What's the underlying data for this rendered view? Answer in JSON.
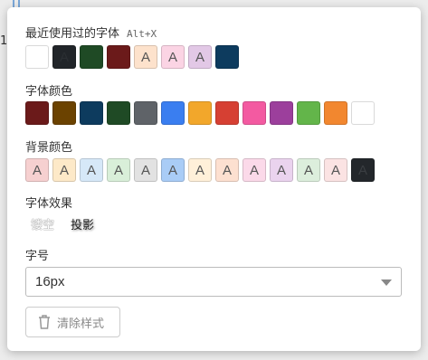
{
  "recent": {
    "title": "最近使用过的字体",
    "shortcut": "Alt+X",
    "swatches": [
      {
        "bg": "#ffffff",
        "letter": "",
        "fg": "#555"
      },
      {
        "bg": "#212529",
        "letter": "A",
        "fg": "#2b2f33"
      },
      {
        "bg": "#1f4a25",
        "letter": "",
        "fg": "#555"
      },
      {
        "bg": "#6b1a1a",
        "letter": "",
        "fg": "#555"
      },
      {
        "bg": "#fde2cc",
        "letter": "A",
        "fg": "#555"
      },
      {
        "bg": "#fbd4e4",
        "letter": "A",
        "fg": "#555"
      },
      {
        "bg": "#e2c8e6",
        "letter": "A",
        "fg": "#555"
      },
      {
        "bg": "#0d3b5e",
        "letter": "",
        "fg": "#555"
      }
    ]
  },
  "font_color": {
    "title": "字体颜色",
    "swatches": [
      "#6b1a1a",
      "#6b4200",
      "#0d3b5e",
      "#1f4a25",
      "#5f6368",
      "#3a7ef0",
      "#f2a72b",
      "#d64033",
      "#f35aa1",
      "#9c3f9c",
      "#63b54a",
      "#f2872f",
      "#ffffff"
    ]
  },
  "bg_color": {
    "title": "背景颜色",
    "swatches": [
      {
        "bg": "#f6d0d0",
        "letter": "A",
        "fg": "#555"
      },
      {
        "bg": "#fde9c8",
        "letter": "A",
        "fg": "#555"
      },
      {
        "bg": "#d6e8f8",
        "letter": "A",
        "fg": "#555"
      },
      {
        "bg": "#d9efd9",
        "letter": "A",
        "fg": "#555"
      },
      {
        "bg": "#e2e2e2",
        "letter": "A",
        "fg": "#555"
      },
      {
        "bg": "#a9ccf6",
        "letter": "A",
        "fg": "#555"
      },
      {
        "bg": "#fff0d9",
        "letter": "A",
        "fg": "#555"
      },
      {
        "bg": "#fde0d0",
        "letter": "A",
        "fg": "#555"
      },
      {
        "bg": "#fbd9e9",
        "letter": "A",
        "fg": "#555"
      },
      {
        "bg": "#ead3ee",
        "letter": "A",
        "fg": "#555"
      },
      {
        "bg": "#dceedc",
        "letter": "A",
        "fg": "#555"
      },
      {
        "bg": "#fbe3e3",
        "letter": "A",
        "fg": "#555"
      },
      {
        "bg": "#23272b",
        "letter": "A",
        "fg": "#3a3e42"
      }
    ]
  },
  "effects": {
    "title": "字体效果",
    "hollow": "镂空",
    "shadow": "投影"
  },
  "font_size": {
    "title": "字号",
    "selected": "16px"
  },
  "clear": {
    "label": "清除样式",
    "icon": "trash-icon"
  },
  "background": {
    "line_number": "1"
  }
}
